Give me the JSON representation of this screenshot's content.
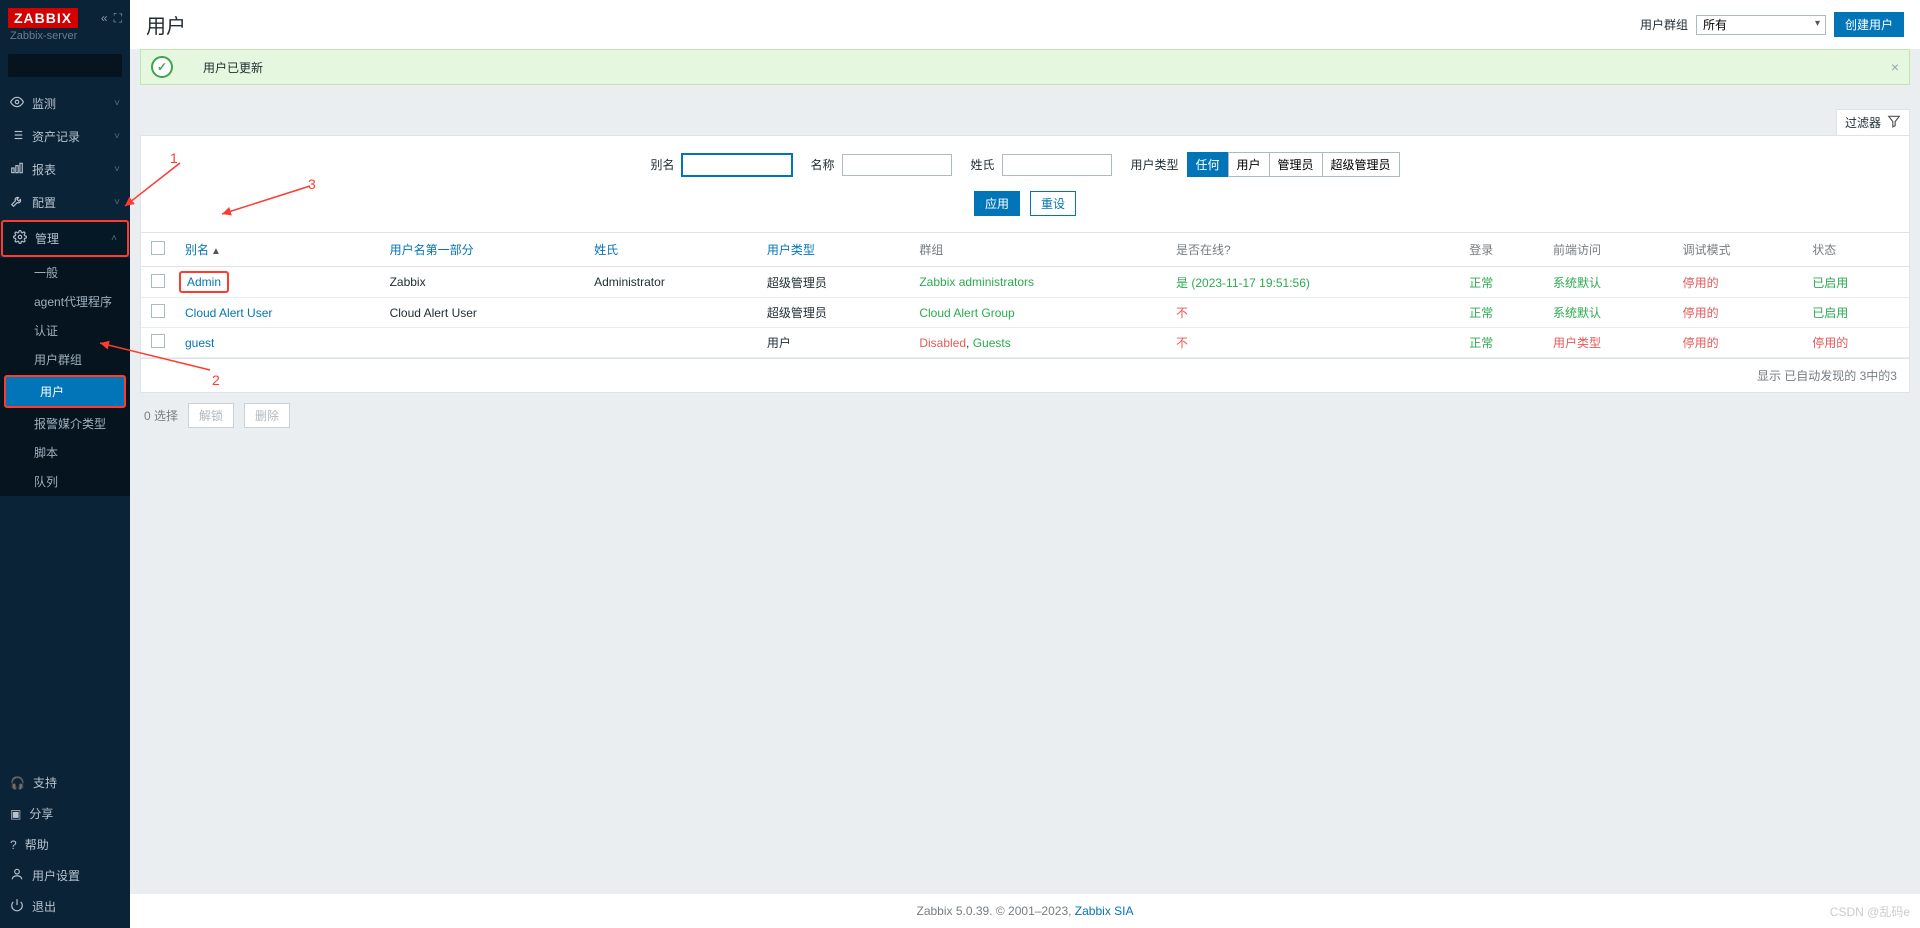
{
  "logo": "ZABBIX",
  "server_name": "Zabbix-server",
  "nav": {
    "monitoring": "监测",
    "inventory": "资产记录",
    "reports": "报表",
    "config": "配置",
    "admin": "管理",
    "sub": {
      "general": "一般",
      "agent": "agent代理程序",
      "auth": "认证",
      "usergroups": "用户群组",
      "users": "用户",
      "mediatypes": "报警媒介类型",
      "scripts": "脚本",
      "queue": "队列"
    }
  },
  "bottom_nav": {
    "support": "支持",
    "share": "分享",
    "help": "帮助",
    "profile": "用户设置",
    "logout": "退出"
  },
  "page_title": "用户",
  "header": {
    "usergroup_label": "用户群组",
    "usergroup_value": "所有",
    "create_user": "创建用户"
  },
  "message_ok": "用户已更新",
  "filter_tab": "过滤器",
  "filter": {
    "alias": "别名",
    "name": "名称",
    "surname": "姓氏",
    "usertype_label": "用户类型",
    "type_any": "任何",
    "type_user": "用户",
    "type_admin": "管理员",
    "type_super": "超级管理员",
    "apply": "应用",
    "reset": "重设"
  },
  "columns": {
    "alias": "别名",
    "firstname": "用户名第一部分",
    "surname": "姓氏",
    "usertype": "用户类型",
    "groups": "群组",
    "online": "是否在线?",
    "login": "登录",
    "frontend": "前端访问",
    "debug": "调试模式",
    "status": "状态"
  },
  "rows": [
    {
      "alias": "Admin",
      "firstname": "Zabbix",
      "surname": "Administrator",
      "usertype": "超级管理员",
      "groups": "Zabbix administrators",
      "online": "是 (2023-11-17 19:51:56)",
      "online_red": false,
      "login": "正常",
      "frontend": "系统默认",
      "frontend_red": false,
      "debug": "停用的",
      "status": "已启用",
      "status_red": false
    },
    {
      "alias": "Cloud Alert User",
      "firstname": "Cloud Alert User",
      "surname": "",
      "usertype": "超级管理员",
      "groups": "Cloud Alert Group",
      "online": "不",
      "online_red": true,
      "login": "正常",
      "frontend": "系统默认",
      "frontend_red": false,
      "debug": "停用的",
      "status": "已启用",
      "status_red": false
    },
    {
      "alias": "guest",
      "firstname": "",
      "surname": "",
      "usertype": "用户",
      "groups_html": true,
      "groups_disabled": "Disabled",
      "groups_guests": "Guests",
      "online": "不",
      "online_red": true,
      "login": "正常",
      "frontend": "用户类型",
      "frontend_red": true,
      "debug": "停用的",
      "status": "停用的",
      "status_red": true
    }
  ],
  "table_footer": "显示 已自动发现的 3中的3",
  "bulk": {
    "selected": "0 选择",
    "unblock": "解锁",
    "delete": "删除"
  },
  "footer": {
    "text1": "Zabbix 5.0.39. © 2001–2023, ",
    "link": "Zabbix SIA"
  },
  "watermark": "CSDN @乱码e",
  "annotations": {
    "a1": "1",
    "a2": "2",
    "a3": "3"
  }
}
